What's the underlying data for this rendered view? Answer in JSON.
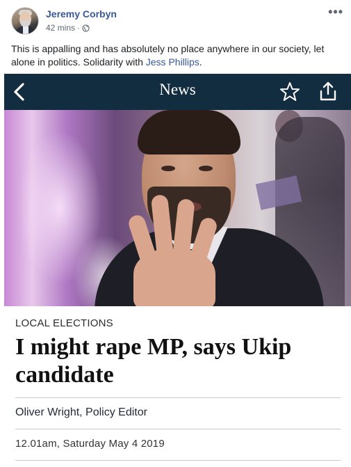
{
  "post": {
    "author": "Jeremy Corbyn",
    "time": "42 mins",
    "separator": "·",
    "text_before": "This is appalling and has absolutely no place anywhere in our society, let alone in politics. Solidarity with ",
    "mention": "Jess Phillips",
    "text_after": ".",
    "more_icon": "more-options-icon",
    "privacy_icon": "globe-icon"
  },
  "article_screenshot": {
    "nav": {
      "back_icon": "chevron-left-icon",
      "title": "News",
      "star_icon": "star-outline-icon",
      "share_icon": "share-icon",
      "background": "#122c40"
    },
    "kicker": "LOCAL ELECTIONS",
    "headline_line1": "I might rape MP, says Ukip",
    "headline_line2": "candidate",
    "byline": "Oliver Wright, Policy Editor",
    "dateline": "12.01am, Saturday May 4 2019"
  },
  "colors": {
    "author_link": "#385898",
    "meta_text": "#606770",
    "nav_bg": "#122c40"
  }
}
